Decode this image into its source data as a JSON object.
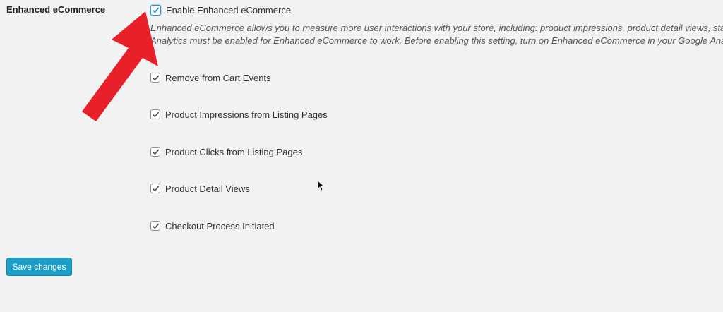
{
  "settings": {
    "row_label": "Enhanced eCommerce",
    "enable": {
      "label": "Enable Enhanced eCommerce",
      "checked": true
    },
    "description": [
      "Enhanced eCommerce allows you to measure more user interactions with your store, including: product impressions, product detail views, start",
      "Analytics must be enabled for Enhanced eCommerce to work. Before enabling this setting, turn on Enhanced eCommerce in your Google Analyt"
    ],
    "options": [
      {
        "label": "Remove from Cart Events",
        "checked": true
      },
      {
        "label": "Product Impressions from Listing Pages",
        "checked": true
      },
      {
        "label": "Product Clicks from Listing Pages",
        "checked": true
      },
      {
        "label": "Product Detail Views",
        "checked": true
      },
      {
        "label": "Checkout Process Initiated",
        "checked": true
      }
    ]
  },
  "actions": {
    "save_label": "Save changes"
  },
  "colors": {
    "background": "#f2f2f2",
    "button": "#1c9ec6",
    "arrow": "#e8202a",
    "focus_ring": "#2c8fcf"
  },
  "icons": {
    "check": "checkmark-icon",
    "annotation": "red-arrow-icon",
    "pointer": "mouse-cursor-icon"
  }
}
